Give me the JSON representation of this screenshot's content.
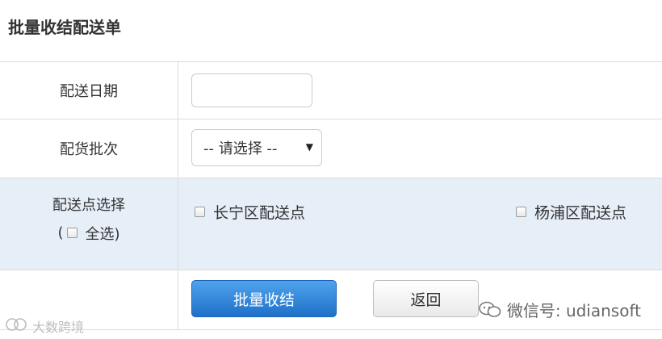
{
  "page": {
    "title": "批量收结配送单"
  },
  "form": {
    "date": {
      "label": "配送日期",
      "value": "",
      "placeholder": ""
    },
    "batch": {
      "label": "配货批次",
      "selected": "-- 请选择 --"
    },
    "points": {
      "label": "配送点选择",
      "select_all_prefix": "(",
      "select_all_label": "全选)",
      "options": [
        {
          "label": "长宁区配送点",
          "checked": false
        },
        {
          "label": "杨浦区配送点",
          "checked": false
        }
      ]
    },
    "actions": {
      "submit_label": "批量收结",
      "back_label": "返回"
    }
  },
  "watermarks": {
    "wechat_text": "微信号: udiansoft",
    "corner_text": "大数跨境"
  },
  "colors": {
    "primary_button": "#1f70c8",
    "highlight_row": "#e6eef7"
  },
  "icons": {
    "select_arrow": "caret-down-icon",
    "wechat": "wechat-icon"
  }
}
